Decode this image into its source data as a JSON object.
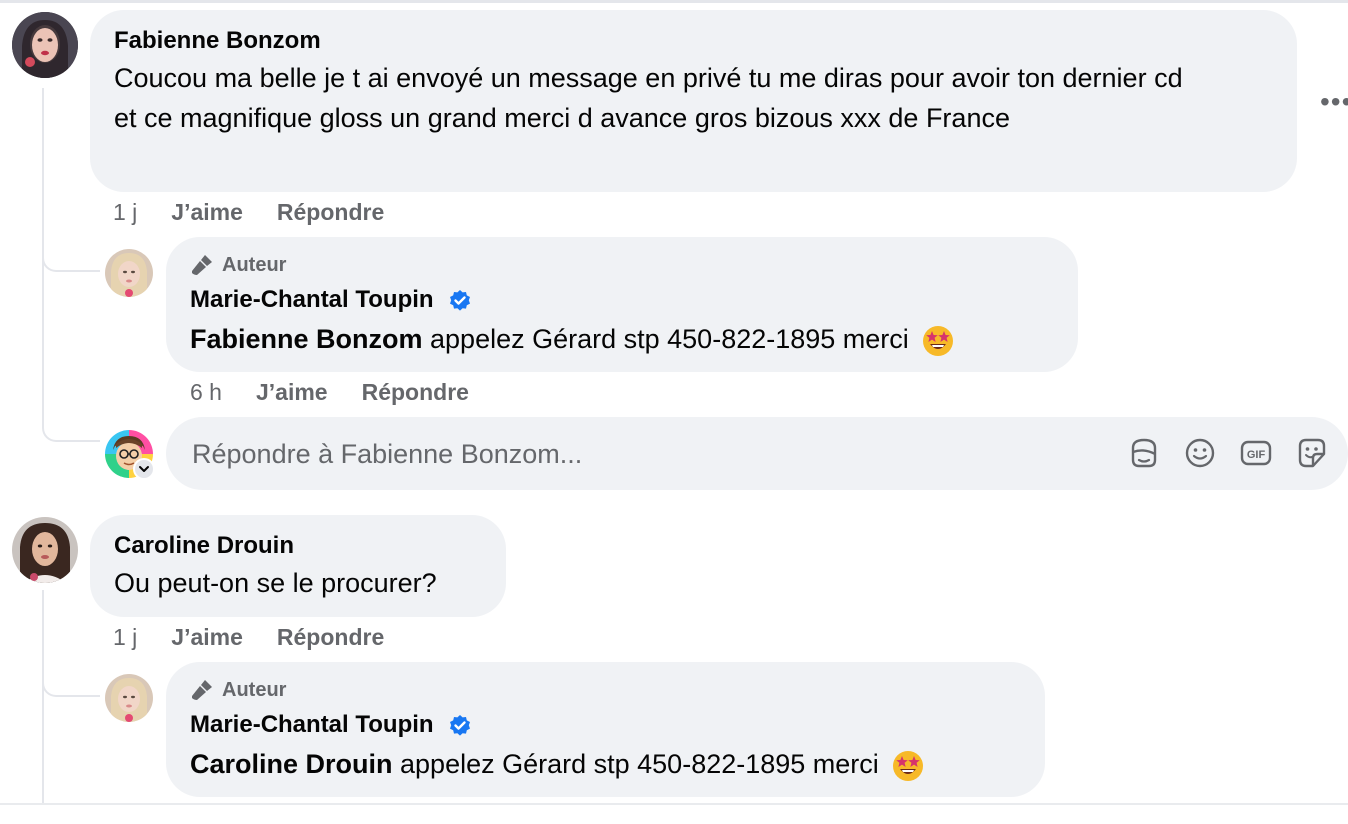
{
  "comments": [
    {
      "author": "Fabienne Bonzom",
      "text": "Coucou ma belle je t ai envoyé un message en privé tu me diras pour avoir ton dernier cd et ce magnifique gloss un grand merci d avance gros bizous xxx de France",
      "time": "1 j",
      "like_label": "J’aime",
      "reply_label": "Répondre",
      "reply": {
        "badge": "Auteur",
        "author": "Marie-Chantal Toupin",
        "mention": "Fabienne Bonzom",
        "text": " appelez Gérard stp 450-822-1895 merci",
        "time": "6 h",
        "like_label": "J’aime",
        "reply_label": "Répondre"
      }
    },
    {
      "author": "Caroline Drouin",
      "text": "Ou peut-on se le procurer?",
      "time": "1 j",
      "like_label": "J’aime",
      "reply_label": "Répondre",
      "reply": {
        "badge": "Auteur",
        "author": "Marie-Chantal Toupin",
        "mention": "Caroline Drouin",
        "text": " appelez Gérard stp 450-822-1895 merci"
      }
    }
  ],
  "reply_input": {
    "placeholder": "Répondre à Fabienne Bonzom..."
  },
  "colors": {
    "bubble": "#f0f2f5",
    "secondary_text": "#65676b",
    "verified": "#1877f2"
  }
}
